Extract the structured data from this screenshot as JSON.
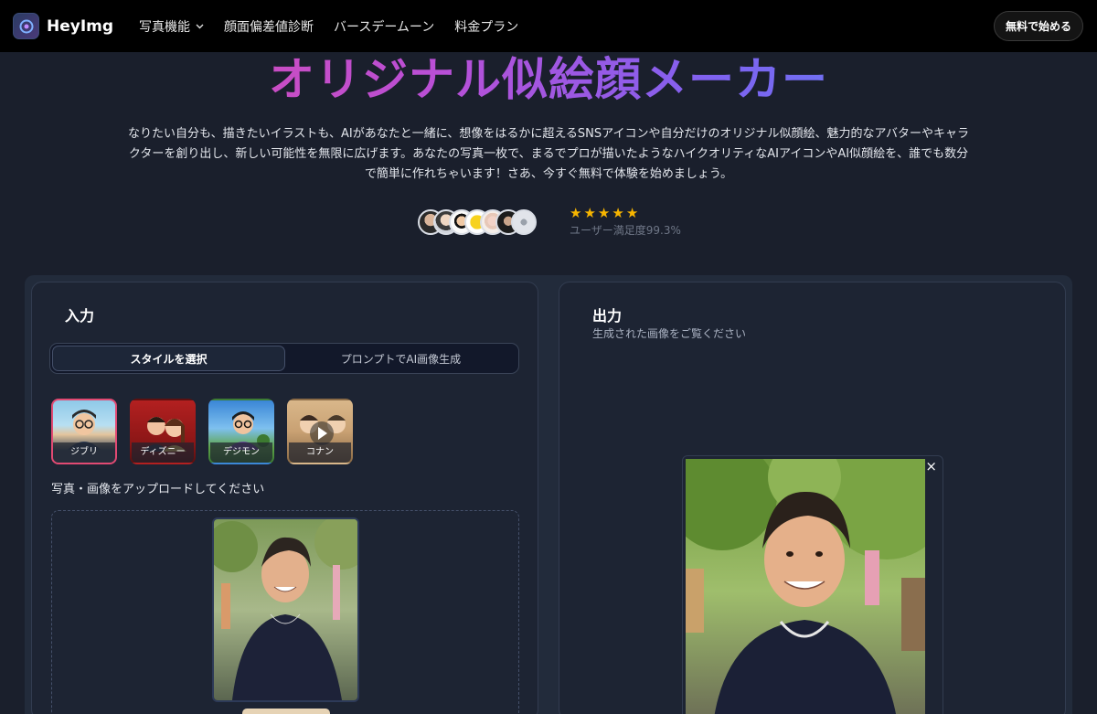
{
  "nav": {
    "brand": "HeyImg",
    "links": [
      {
        "label": "写真機能",
        "has_dropdown": true
      },
      {
        "label": "顔面偏差値診断"
      },
      {
        "label": "バースデームーン"
      },
      {
        "label": "料金プラン"
      }
    ],
    "cta": "無料で始める"
  },
  "hero": {
    "title": "オリジナル似絵顔メーカー",
    "description": "なりたい自分も、描きたいイラストも、AIがあなたと一緒に、想像をはるかに超えるSNSアイコンや自分だけのオリジナル似顔絵、魅力的なアバターやキャラクターを創り出し、新しい可能性を無限に広げます。あなたの写真一枚で、まるでプロが描いたようなハイクオリティなAIアイコンやAI似顔絵を、誰でも数分で簡単に作れちゃいます！さあ、今すぐ無料で体験を始めましょう。",
    "rating_stars": 5,
    "rating_text": "ユーザー満足度99.3%"
  },
  "input_panel": {
    "title": "入力",
    "tabs": [
      {
        "label": "スタイルを選択",
        "active": true
      },
      {
        "label": "プロンプトでAI画像生成",
        "active": false
      }
    ],
    "styles": [
      {
        "label": "ジブリ",
        "selected": true
      },
      {
        "label": "ディズニー",
        "selected": false
      },
      {
        "label": "デジモン",
        "selected": false
      },
      {
        "label": "コナン",
        "selected": false
      }
    ],
    "upload_label": "写真・画像をアップロードしてください"
  },
  "output_panel": {
    "title": "出力",
    "subtitle": "生成された画像をご覧ください",
    "close_glyph": "×"
  },
  "colors": {
    "accent_pink": "#e24a73",
    "star": "#f7b500",
    "title_gradient": [
      "#e14aa7",
      "#b94fd6",
      "#7f62f0",
      "#4f8df5"
    ]
  }
}
